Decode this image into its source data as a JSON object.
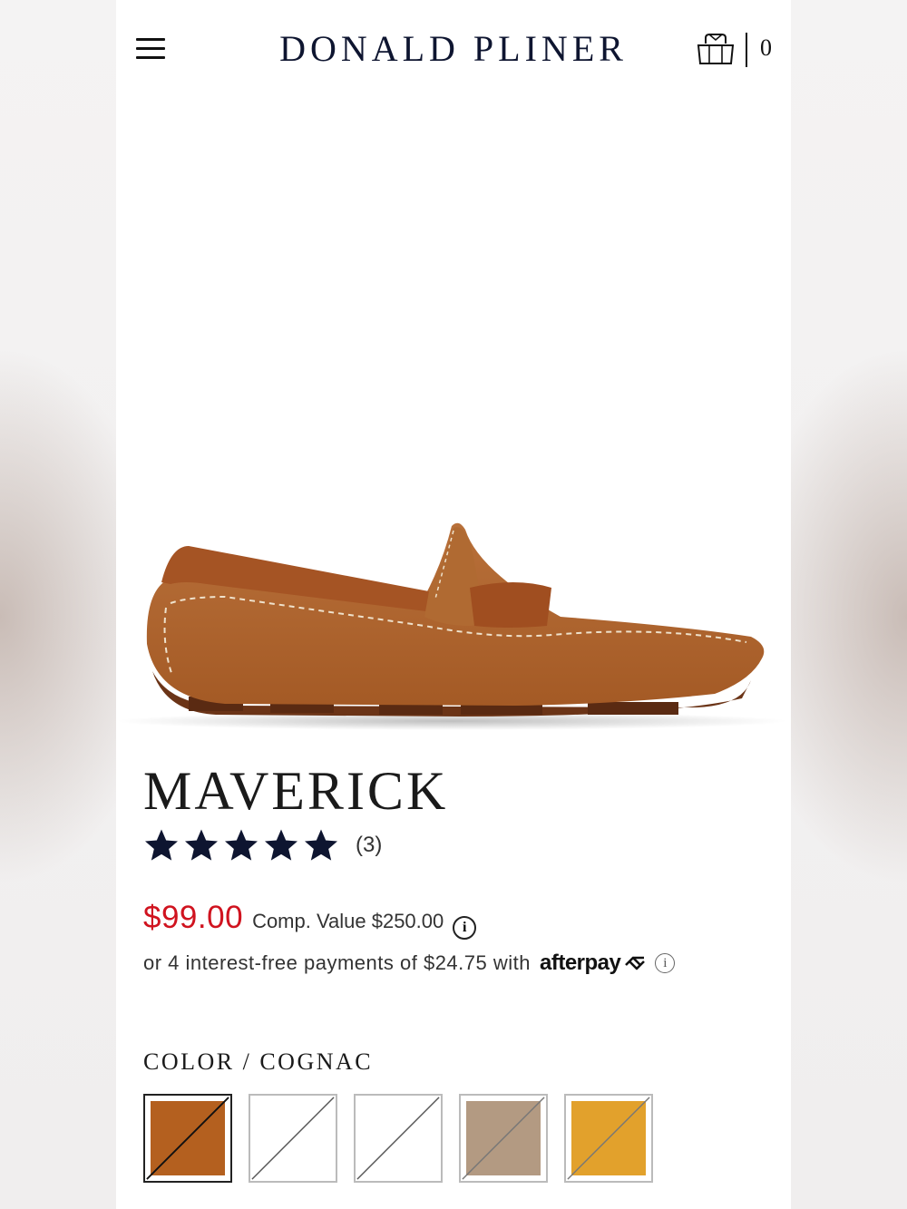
{
  "header": {
    "brand": "DONALD PLINER",
    "cart_count": "0",
    "menu_icon": "hamburger-menu-icon",
    "cart_icon": "shopping-bag-icon"
  },
  "product": {
    "image_alt": "loafer-shoe-image",
    "name": "MAVERICK",
    "rating_stars": 5,
    "rating_max": 5,
    "review_count": "(3)",
    "price": "$99.00",
    "comp_value": "Comp. Value $250.00",
    "info_glyph": "i",
    "afterpay_text": "or 4 interest-free payments of $24.75 with",
    "afterpay_logo": "afterpay",
    "afterpay_info_glyph": "i"
  },
  "color": {
    "label": "COLOR / COGNAC",
    "swatches": [
      {
        "name": "Cognac",
        "color": "#b4601f",
        "available": false,
        "selected": true
      },
      {
        "name": "White",
        "color": "#ffffff",
        "available": false,
        "selected": false
      },
      {
        "name": "White 2",
        "color": "#ffffff",
        "available": false,
        "selected": false
      },
      {
        "name": "Taupe",
        "color": "#b39a82",
        "available": false,
        "selected": false
      },
      {
        "name": "Mustard",
        "color": "#e2a12c",
        "available": false,
        "selected": false
      }
    ]
  },
  "colors": {
    "price_red": "#d0131f",
    "brand_navy": "#0e1530",
    "star": "#0e1530"
  }
}
